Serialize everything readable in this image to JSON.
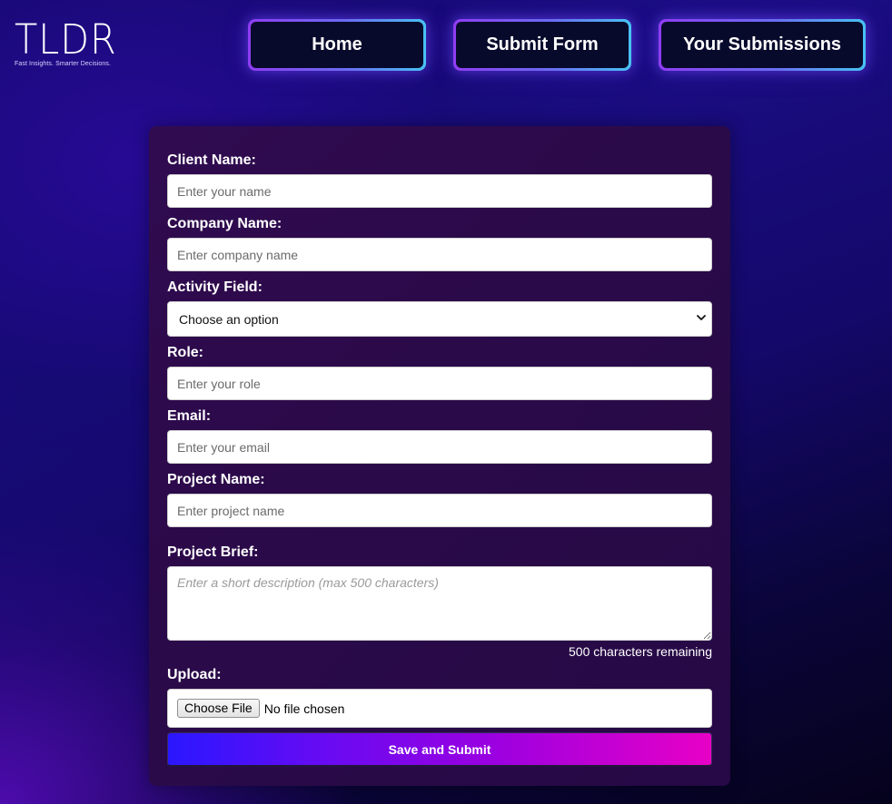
{
  "brand": {
    "logo_text": "TLDR",
    "tagline": "Fast Insights. Smarter Decisions."
  },
  "nav": {
    "home": "Home",
    "submit_form": "Submit Form",
    "your_submissions": "Your Submissions"
  },
  "form": {
    "client_name": {
      "label": "Client Name:",
      "placeholder": "Enter your name",
      "value": ""
    },
    "company_name": {
      "label": "Company Name:",
      "placeholder": "Enter company name",
      "value": ""
    },
    "activity_field": {
      "label": "Activity Field:",
      "selected": "Choose an option"
    },
    "role": {
      "label": "Role:",
      "placeholder": "Enter your role",
      "value": ""
    },
    "email": {
      "label": "Email:",
      "placeholder": "Enter your email",
      "value": ""
    },
    "project_name": {
      "label": "Project Name:",
      "placeholder": "Enter project name",
      "value": ""
    },
    "project_brief": {
      "label": "Project Brief:",
      "placeholder": "Enter a short description (max 500 characters)",
      "counter": "500 characters remaining"
    },
    "upload": {
      "label": "Upload:",
      "button": "Choose File",
      "status": "No file chosen"
    },
    "submit_label": "Save and Submit"
  },
  "colors": {
    "nav_border_start": "#8f3cf2",
    "nav_border_end": "#47c2f2",
    "nav_fill": "#080a2c",
    "card_bg": "#2c0a4a",
    "submit_start": "#2a17ff",
    "submit_end": "#e800c6"
  },
  "icons": {
    "select_arrow": "chevron-down-icon"
  }
}
